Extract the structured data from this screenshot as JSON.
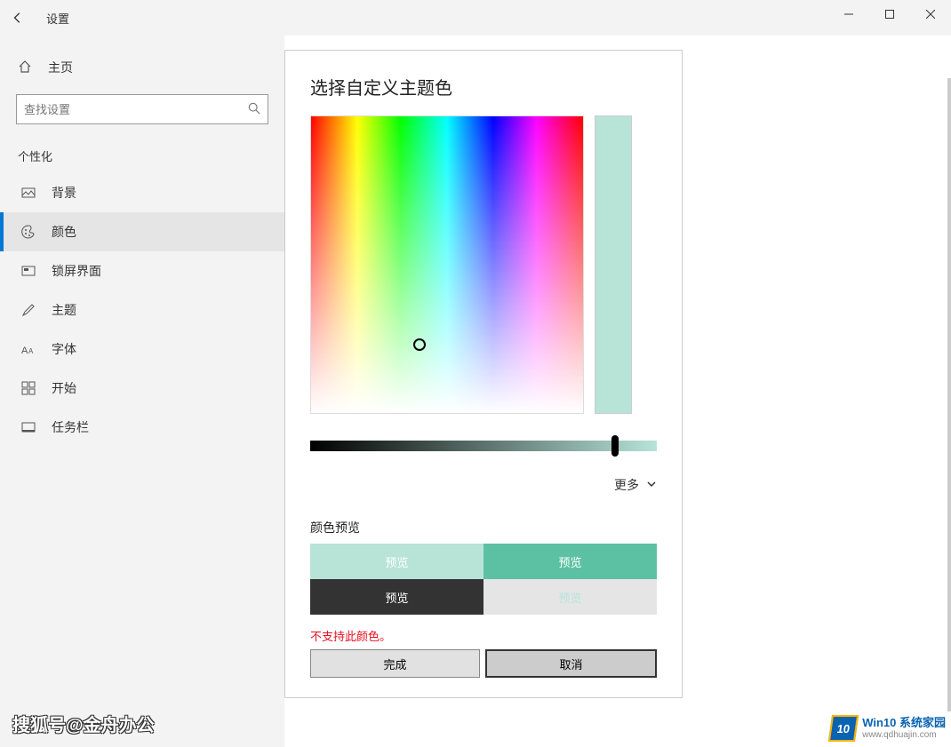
{
  "titlebar": {
    "title": "设置"
  },
  "sidebar": {
    "home": "主页",
    "search_placeholder": "查找设置",
    "section": "个性化",
    "items": [
      {
        "label": "背景"
      },
      {
        "label": "颜色"
      },
      {
        "label": "锁屏界面"
      },
      {
        "label": "主题"
      },
      {
        "label": "字体"
      },
      {
        "label": "开始"
      },
      {
        "label": "任务栏"
      }
    ]
  },
  "dialog": {
    "title": "选择自定义主题色",
    "more": "更多",
    "preview_label": "颜色预览",
    "preview_cells": [
      "预览",
      "预览",
      "预览",
      "预览"
    ],
    "error": "不支持此颜色。",
    "done": "完成",
    "cancel": "取消",
    "selected_color": "#b7e4d7"
  },
  "watermarks": {
    "left": "搜狐号@金舟办公",
    "right_badge": "10",
    "right_line1": "Win10 系统家园",
    "right_line2": "www.qdhuajin.com"
  }
}
